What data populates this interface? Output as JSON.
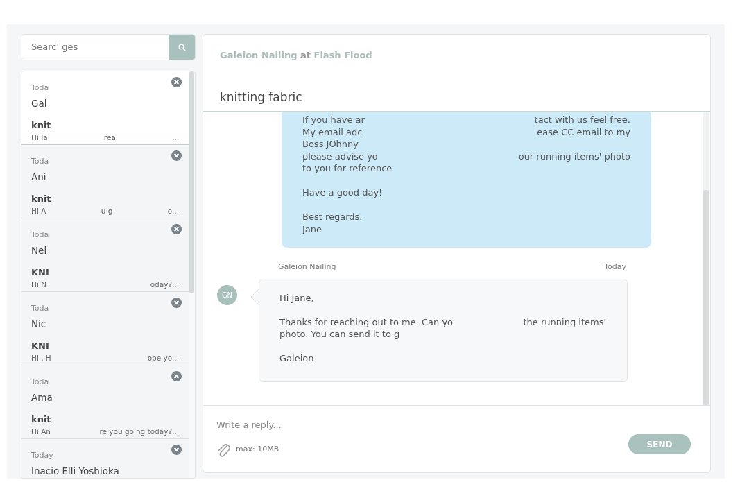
{
  "search": {
    "placeholder": "Searc' ges"
  },
  "conversations": [
    {
      "date": "Toda",
      "name": "Gal",
      "subject": "knit",
      "preview": [
        "Hi Ja",
        "rea",
        "..."
      ],
      "selected": true
    },
    {
      "date": "Toda",
      "name": "Ani",
      "subject": "knit",
      "preview": [
        "Hi A",
        "u g",
        "o..."
      ],
      "selected": false
    },
    {
      "date": "Toda",
      "name": "Nel",
      "subject": "KNI",
      "preview": [
        "Hi N",
        "oday?..."
      ],
      "selected": false
    },
    {
      "date": "Toda",
      "name": "Nic",
      "subject": "KNI",
      "preview": [
        "Hi , H",
        "ope yo..."
      ],
      "selected": false
    },
    {
      "date": "Toda",
      "name": "Ama",
      "subject": "knit",
      "preview": [
        "Hi An",
        "re you going today?..."
      ],
      "selected": false
    },
    {
      "date": "Today",
      "name": "Inacio Elli Yoshioka",
      "selected": false
    }
  ],
  "thread": {
    "header": "**Galeion Nailing** at **Flash Flood**",
    "subject": "knitting fabric",
    "messages": [
      {
        "kind": "outgoing",
        "paragraphs": [
          [
            [
              "If you have ar",
              "tact with us feel free."
            ],
            [
              "My email adc",
              "ease CC email to my"
            ],
            [
              "Boss JOhnny"
            ],
            [
              "please advise yo",
              "our running items' photo"
            ],
            [
              "to you for reference"
            ]
          ],
          [
            [
              "Have a good day!"
            ]
          ],
          [
            [
              "Best regards."
            ],
            [
              "Jane"
            ]
          ]
        ]
      },
      {
        "kind": "incoming",
        "sender": "Galeion Nailing",
        "time": "Today",
        "avatar": "GN",
        "paragraphs": [
          [
            [
              "Hi Jane,"
            ]
          ],
          [
            [
              "Thanks for reaching out to me. Can yo",
              "the running items'"
            ],
            [
              "photo. You can send it to g"
            ]
          ],
          [
            [
              "Galeion"
            ]
          ]
        ]
      }
    ]
  },
  "reply": {
    "placeholder": "Write a reply...",
    "limit": "max: 10MB",
    "send": "SEND"
  }
}
